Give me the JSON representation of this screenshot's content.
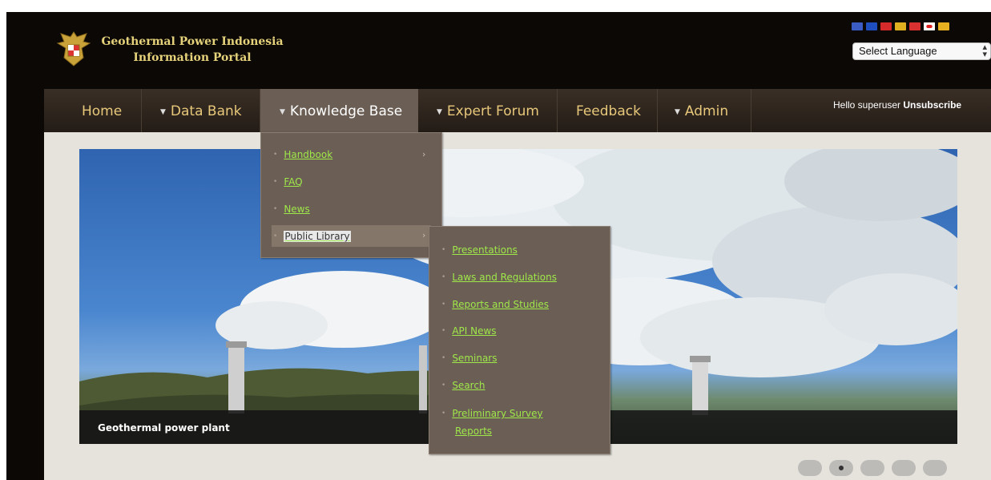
{
  "site": {
    "title_line1": "Geothermal Power Indonesia",
    "title_line2": "Information Portal",
    "logo_icon": "garuda-emblem-icon"
  },
  "language": {
    "flags": [
      {
        "name": "us-flag-icon",
        "color": "#3b5cc4"
      },
      {
        "name": "ph-flag-icon",
        "color": "#1f4fbf"
      },
      {
        "name": "fr-flag-icon",
        "color": "#d42a2a"
      },
      {
        "name": "de-flag-icon",
        "color": "#e0b020"
      },
      {
        "name": "id-flag-icon",
        "color": "#d93030"
      },
      {
        "name": "jp-flag-icon",
        "color": "#ffffff"
      },
      {
        "name": "es-flag-icon",
        "color": "#e8b020"
      }
    ],
    "select_value": "Select Language"
  },
  "nav": {
    "home": "Home",
    "data_bank": "Data Bank",
    "knowledge_base": "Knowledge Base",
    "expert_forum": "Expert Forum",
    "feedback": "Feedback",
    "admin": "Admin"
  },
  "user": {
    "greeting": "Hello superuser",
    "unsubscribe": "Unsubscribe"
  },
  "knowledge_menu": {
    "items": [
      "Handbook",
      "FAQ",
      "News",
      "Public Library"
    ]
  },
  "public_library_menu": {
    "items": [
      "Presentations",
      "Laws and Regulations",
      "Reports and Studies",
      "API News",
      "Seminars",
      "Search",
      "Preliminary Survey",
      "Reports"
    ]
  },
  "hero": {
    "caption": "Geothermal power plant"
  },
  "slider": {
    "count": 5,
    "active_index": 1
  },
  "colors": {
    "accent_gold": "#e8c87a",
    "menu_link_green": "#9fe84a",
    "menu_bg": "#6b5e54"
  }
}
